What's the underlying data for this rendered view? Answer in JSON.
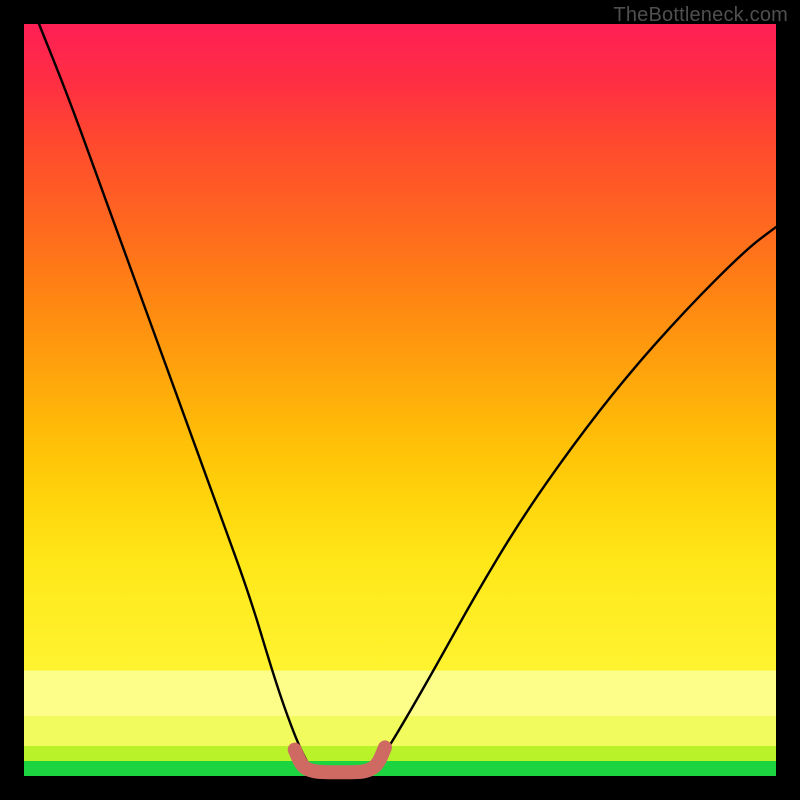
{
  "watermark": "TheBottleneck.com",
  "colors": {
    "curve": "#000000",
    "highlight": "#cf6a63",
    "frame": "#000000"
  },
  "chart_data": {
    "type": "line",
    "title": "",
    "xlabel": "",
    "ylabel": "",
    "xlim": [
      0,
      100
    ],
    "ylim": [
      0,
      100
    ],
    "series": [
      {
        "name": "left-branch",
        "x": [
          2,
          6,
          10,
          14,
          18,
          22,
          26,
          30,
          33,
          35,
          37,
          38.5
        ],
        "y": [
          100,
          90,
          79,
          68,
          57,
          46,
          35,
          24,
          14,
          8,
          3,
          0.5
        ]
      },
      {
        "name": "right-branch",
        "x": [
          46,
          48,
          51,
          55,
          60,
          66,
          73,
          80,
          88,
          96,
          100
        ],
        "y": [
          0.5,
          3,
          8,
          15,
          24,
          34,
          44,
          53,
          62,
          70,
          73
        ]
      },
      {
        "name": "trough-highlight",
        "x": [
          36,
          37,
          38.5,
          40,
          42,
          44,
          45.5,
          47,
          48
        ],
        "y": [
          3.5,
          1.2,
          0.6,
          0.5,
          0.5,
          0.5,
          0.6,
          1.4,
          3.8
        ]
      }
    ],
    "annotations": []
  }
}
